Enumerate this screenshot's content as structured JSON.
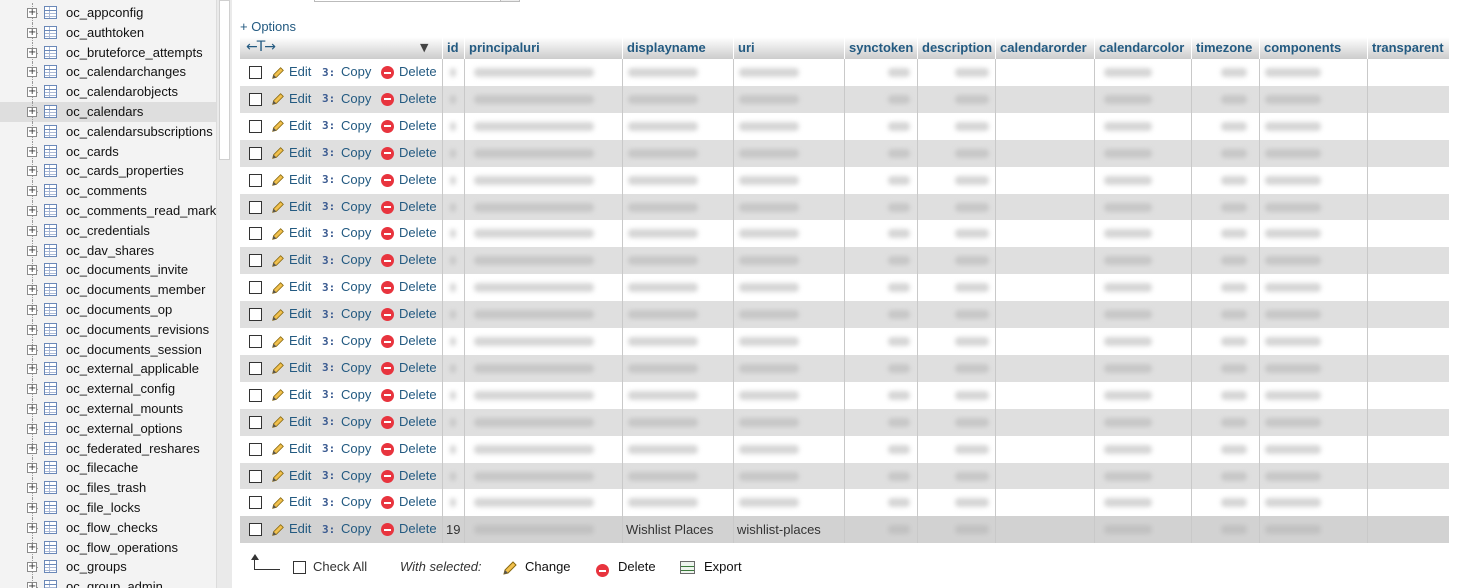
{
  "nav": {
    "selected_index": 5,
    "items": [
      {
        "label": "oc_appconfig"
      },
      {
        "label": "oc_authtoken"
      },
      {
        "label": "oc_bruteforce_attempts"
      },
      {
        "label": "oc_calendarchanges"
      },
      {
        "label": "oc_calendarobjects"
      },
      {
        "label": "oc_calendars"
      },
      {
        "label": "oc_calendarsubscriptions"
      },
      {
        "label": "oc_cards"
      },
      {
        "label": "oc_cards_properties"
      },
      {
        "label": "oc_comments"
      },
      {
        "label": "oc_comments_read_mark"
      },
      {
        "label": "oc_credentials"
      },
      {
        "label": "oc_dav_shares"
      },
      {
        "label": "oc_documents_invite"
      },
      {
        "label": "oc_documents_member"
      },
      {
        "label": "oc_documents_op"
      },
      {
        "label": "oc_documents_revisions"
      },
      {
        "label": "oc_documents_session"
      },
      {
        "label": "oc_external_applicable"
      },
      {
        "label": "oc_external_config"
      },
      {
        "label": "oc_external_mounts"
      },
      {
        "label": "oc_external_options"
      },
      {
        "label": "oc_federated_reshares"
      },
      {
        "label": "oc_filecache"
      },
      {
        "label": "oc_files_trash"
      },
      {
        "label": "oc_file_locks"
      },
      {
        "label": "oc_flow_checks"
      },
      {
        "label": "oc_flow_operations"
      },
      {
        "label": "oc_groups"
      },
      {
        "label": "oc_group_admin"
      }
    ]
  },
  "options_label": "+ Options",
  "sort_arrows": "←T→",
  "columns": [
    {
      "label": "id"
    },
    {
      "label": "principaluri"
    },
    {
      "label": "displayname"
    },
    {
      "label": "uri"
    },
    {
      "label": "synctoken"
    },
    {
      "label": "description"
    },
    {
      "label": "calendarorder"
    },
    {
      "label": "calendarcolor"
    },
    {
      "label": "timezone"
    },
    {
      "label": "components"
    },
    {
      "label": "transparent"
    }
  ],
  "row_actions": {
    "edit": "Edit",
    "copy": "Copy",
    "delete": "Delete"
  },
  "row_count": 18,
  "last_row": {
    "id": "19",
    "displayname": "Wishlist Places",
    "uri": "wishlist-places"
  },
  "footer": {
    "check_all": "Check All",
    "with_selected": "With selected:",
    "change": "Change",
    "delete": "Delete",
    "export": "Export"
  }
}
